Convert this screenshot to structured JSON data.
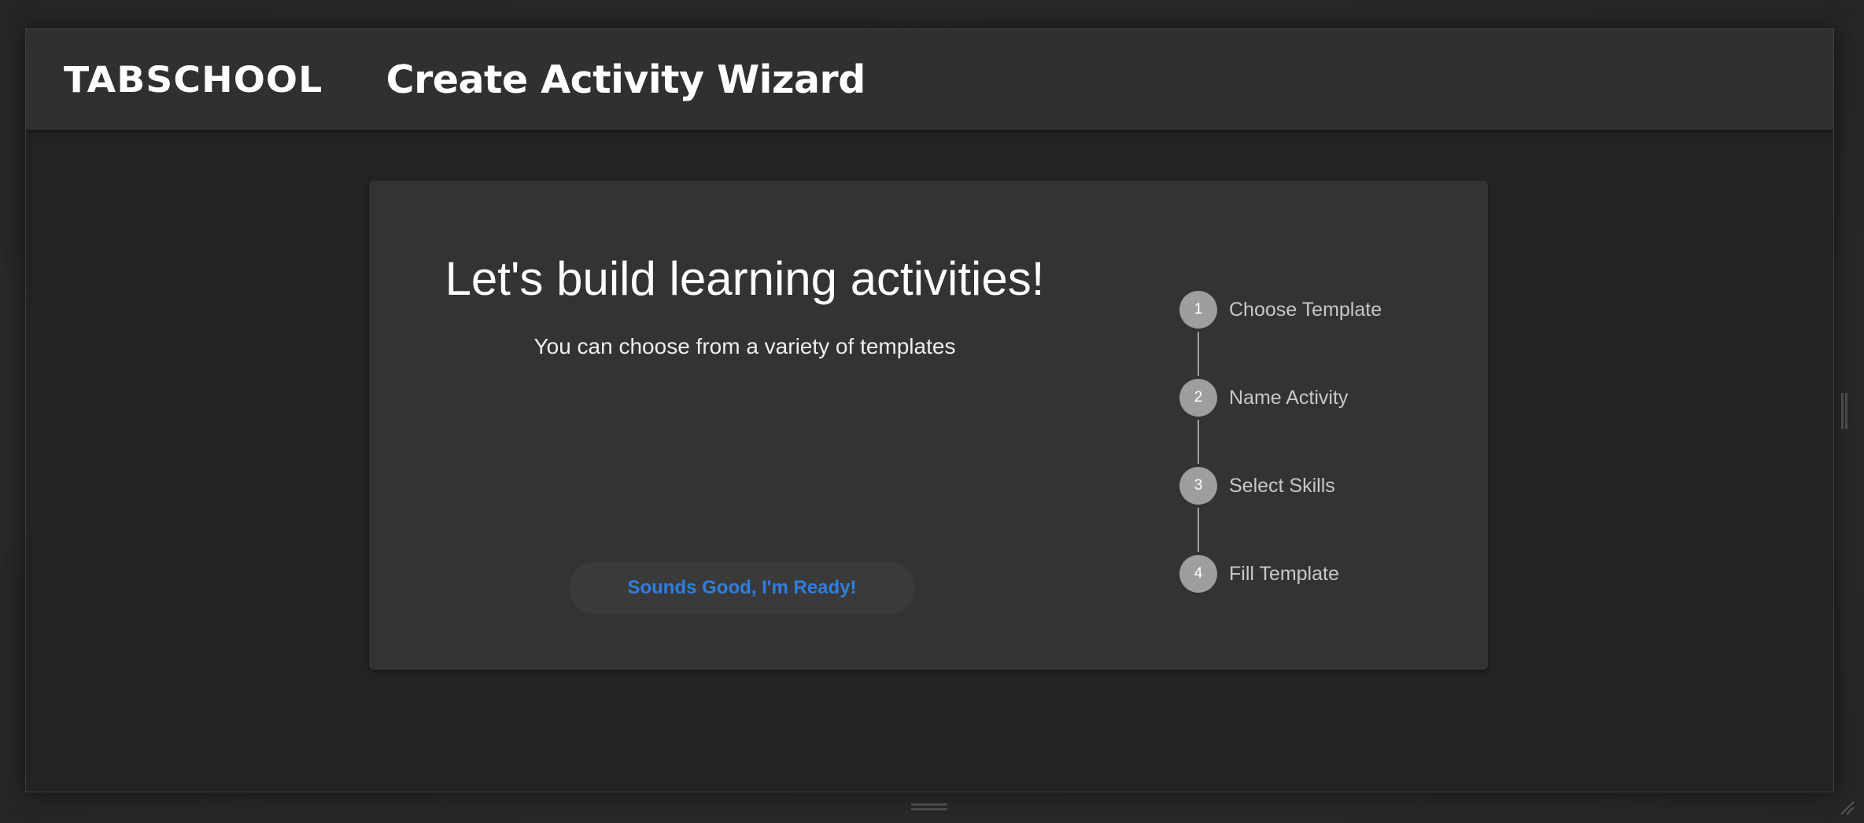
{
  "app": {
    "logo": "TABSCHOOL",
    "title": "Create Activity Wizard"
  },
  "intro": {
    "heading": "Let's build learning activities!",
    "subheading": "You can choose from a variety of templates",
    "ready_button_label": "Sounds Good, I'm Ready!"
  },
  "steps": [
    {
      "number": "1",
      "label": "Choose Template"
    },
    {
      "number": "2",
      "label": "Name Activity"
    },
    {
      "number": "3",
      "label": "Select Skills"
    },
    {
      "number": "4",
      "label": "Fill Template"
    }
  ],
  "colors": {
    "accent_blue": "#2f7ee0",
    "step_circle": "#9e9e9e",
    "appbar": "#303030",
    "card": "#333333",
    "background": "#232323"
  }
}
